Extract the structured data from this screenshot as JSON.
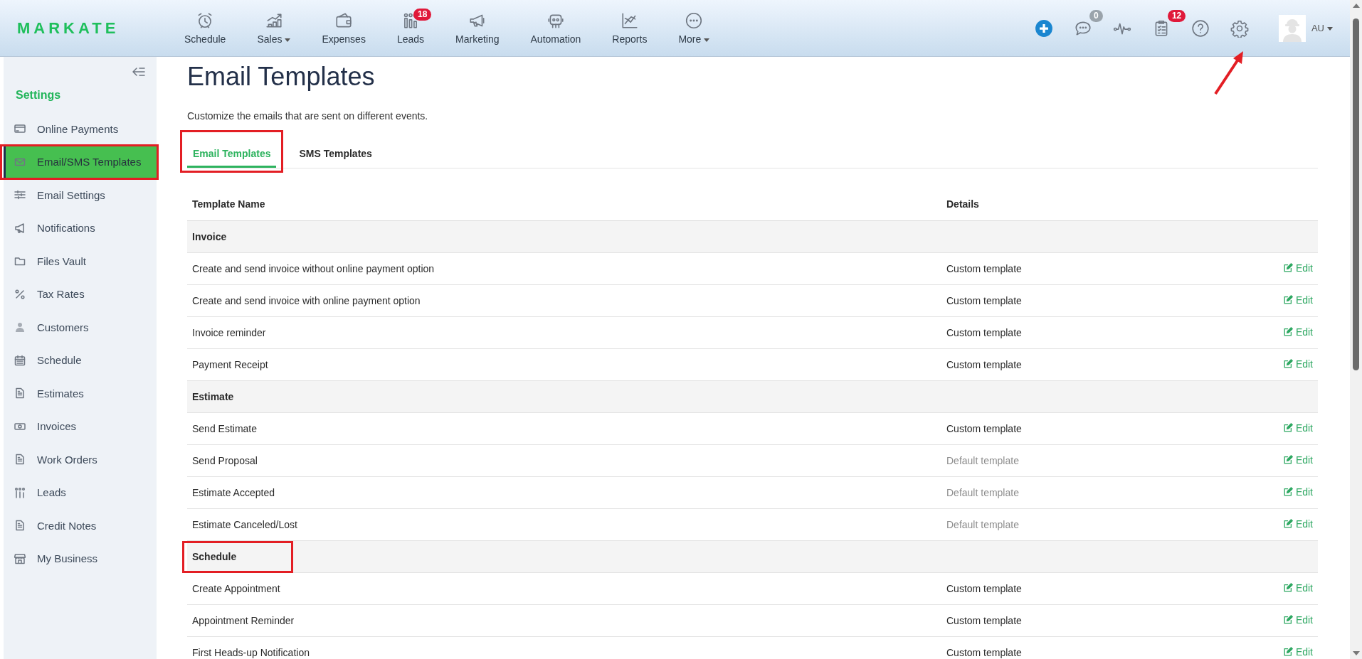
{
  "brand": {
    "logo": "MARKATE"
  },
  "nav": [
    {
      "label": "Schedule",
      "dropdown": false
    },
    {
      "label": "Sales",
      "dropdown": true
    },
    {
      "label": "Expenses",
      "dropdown": false
    },
    {
      "label": "Leads",
      "dropdown": false,
      "badge": "18"
    },
    {
      "label": "Marketing",
      "dropdown": false
    },
    {
      "label": "Automation",
      "dropdown": false
    },
    {
      "label": "Reports",
      "dropdown": false
    },
    {
      "label": "More",
      "dropdown": true
    }
  ],
  "toolbar": [
    {
      "kind": "add"
    },
    {
      "kind": "chat",
      "badge": "0",
      "color": "#9aa3ab"
    },
    {
      "kind": "activity"
    },
    {
      "kind": "tasks",
      "badge": "12",
      "color": "#e0193a"
    },
    {
      "kind": "help"
    },
    {
      "kind": "settings",
      "pointed": true
    }
  ],
  "user": {
    "initials": "AU",
    "dropdown": true
  },
  "sidebar": {
    "heading": "Settings",
    "items": [
      {
        "label": "Online Payments",
        "selected": false,
        "highlighted": false
      },
      {
        "label": "Email/SMS Templates",
        "selected": true,
        "highlighted": true
      },
      {
        "label": "Email Settings",
        "selected": false,
        "highlighted": false
      },
      {
        "label": "Notifications",
        "selected": false,
        "highlighted": false
      },
      {
        "label": "Files Vault",
        "selected": false,
        "highlighted": false
      },
      {
        "label": "Tax Rates",
        "selected": false,
        "highlighted": false
      },
      {
        "label": "Customers",
        "selected": false,
        "highlighted": false
      },
      {
        "label": "Schedule",
        "selected": false,
        "highlighted": false
      },
      {
        "label": "Estimates",
        "selected": false,
        "highlighted": false
      },
      {
        "label": "Invoices",
        "selected": false,
        "highlighted": false
      },
      {
        "label": "Work Orders",
        "selected": false,
        "highlighted": false
      },
      {
        "label": "Leads",
        "selected": false,
        "highlighted": false
      },
      {
        "label": "Credit Notes",
        "selected": false,
        "highlighted": false
      },
      {
        "label": "My Business",
        "selected": false,
        "highlighted": false
      }
    ]
  },
  "page": {
    "title": "Email Templates",
    "description": "Customize the emails that are sent on different events.",
    "tabs": [
      {
        "label": "Email Templates",
        "selected": true,
        "highlighted": true
      },
      {
        "label": "SMS Templates",
        "selected": false,
        "highlighted": false
      }
    ],
    "table": {
      "columns": [
        "Template Name",
        "Details"
      ],
      "groups": [
        {
          "name": "Invoice",
          "highlighted": false,
          "rows": [
            {
              "name": "Create and send invoice without online payment option",
              "details": "Custom template",
              "default": false,
              "action": "Edit"
            },
            {
              "name": "Create and send invoice with online payment option",
              "details": "Custom template",
              "default": false,
              "action": "Edit"
            },
            {
              "name": "Invoice reminder",
              "details": "Custom template",
              "default": false,
              "action": "Edit"
            },
            {
              "name": "Payment Receipt",
              "details": "Custom template",
              "default": false,
              "action": "Edit"
            }
          ]
        },
        {
          "name": "Estimate",
          "highlighted": false,
          "rows": [
            {
              "name": "Send Estimate",
              "details": "Custom template",
              "default": false,
              "action": "Edit"
            },
            {
              "name": "Send Proposal",
              "details": "Default template",
              "default": true,
              "action": "Edit"
            },
            {
              "name": "Estimate Accepted",
              "details": "Default template",
              "default": true,
              "action": "Edit"
            },
            {
              "name": "Estimate Canceled/Lost",
              "details": "Default template",
              "default": true,
              "action": "Edit"
            }
          ]
        },
        {
          "name": "Schedule",
          "highlighted": true,
          "rows": [
            {
              "name": "Create Appointment",
              "details": "Custom template",
              "default": false,
              "action": "Edit"
            },
            {
              "name": "Appointment Reminder",
              "details": "Custom template",
              "default": false,
              "action": "Edit"
            },
            {
              "name": "First Heads-up Notification",
              "details": "Custom template",
              "default": false,
              "action": "Edit"
            }
          ]
        }
      ]
    }
  }
}
